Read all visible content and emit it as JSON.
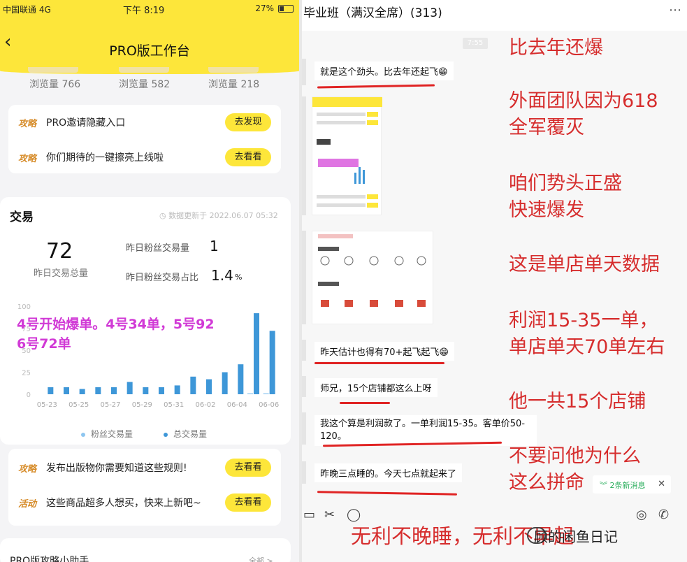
{
  "phone": {
    "status": {
      "carrier": "中国联通",
      "network": "4G",
      "time": "下午 8:19",
      "battery": "27%"
    },
    "nav": {
      "back_icon": "chevron-left-icon",
      "title": "PRO版工作台"
    },
    "views": [
      "浏览量 766",
      "浏览量 582",
      "浏览量 218"
    ],
    "promo_top": [
      {
        "tag": "攻略",
        "text": "PRO邀请隐藏入口",
        "button": "去发现"
      },
      {
        "tag": "攻略",
        "text": "你们期待的一键擦亮上线啦",
        "button": "去看看"
      }
    ],
    "trade": {
      "title": "交易",
      "updated": "数据更新于 2022.06.07 05:32",
      "total_value": "72",
      "total_label": "昨日交易总量",
      "fan_count_label": "昨日粉丝交易量",
      "fan_count_value": "1",
      "fan_ratio_label": "昨日粉丝交易占比",
      "fan_ratio_value": "1.4",
      "fan_ratio_unit": "%",
      "legend": [
        "粉丝交易量",
        "总交易量"
      ]
    },
    "overlay_note": [
      "4号开始爆单。4号34单，5号92",
      "6号72单"
    ],
    "promo_bottom": [
      {
        "tag": "攻略",
        "text": "发布出版物你需要知道这些规则!",
        "button": "去看看"
      },
      {
        "tag": "活动",
        "text": "这些商品超多人想买，快来上新吧~",
        "button": "去看看"
      }
    ],
    "footer": {
      "title": "PRO版攻略小助手",
      "more": "全部 >"
    }
  },
  "chart_data": {
    "type": "bar",
    "categories": [
      "05-23",
      "05-24",
      "05-25",
      "05-26",
      "05-27",
      "05-28",
      "05-29",
      "05-30",
      "05-31",
      "06-01",
      "06-02",
      "06-03",
      "06-04",
      "06-05",
      "06-06"
    ],
    "x_tick_labels": [
      "05-23",
      "05-25",
      "05-27",
      "05-29",
      "05-31",
      "06-02",
      "06-04",
      "06-06"
    ],
    "series": [
      {
        "name": "粉丝交易量",
        "values": [
          0,
          0,
          0,
          0,
          0,
          0,
          0,
          0,
          0,
          0,
          0,
          0,
          0,
          1,
          1
        ]
      },
      {
        "name": "总交易量",
        "values": [
          8,
          8,
          6,
          8,
          8,
          14,
          8,
          8,
          10,
          20,
          17,
          25,
          34,
          92,
          72
        ]
      }
    ],
    "y_ticks": [
      0,
      25,
      50,
      75,
      100
    ],
    "ylim": [
      0,
      100
    ],
    "grid": false,
    "colors": {
      "fan": "#8ec6f0",
      "total": "#3e97d8"
    }
  },
  "chat": {
    "title": "毕业班（满汉全席）(313)",
    "more_icon": "more-horizontal-icon",
    "time_badge": "7:55",
    "messages": [
      "就是这个劲头。比去年还起飞😁",
      "昨天估计也得有70+起飞起飞😁",
      "师兄，15个店铺都这么上呀",
      "我这个算是利润款了。一单利润15-35。客单价50-120。",
      "昨晚三点睡的。今天七点就起来了"
    ],
    "new_messages": "2条新消息",
    "toolbar_icons": [
      "folder-icon",
      "scissors-icon",
      "chat-icon",
      "camera-icon",
      "phone-icon"
    ]
  },
  "annotations": [
    "比去年还爆",
    "外面团队因为618",
    "全军覆灭",
    "咱们势头正盛",
    "快速爆发",
    "这是单店单天数据",
    "利润15-35一单，",
    "单店单天70单左右",
    "他一共15个店铺",
    "不要问他为什么",
    "这么拼命",
    "无利不晚睡，无利不早起"
  ],
  "watermark": "顾的闲鱼日记",
  "colors": {
    "brand_yellow": "#fde63a",
    "annotation_red": "#d62d2d",
    "overlay_purple": "#d13ad6"
  }
}
